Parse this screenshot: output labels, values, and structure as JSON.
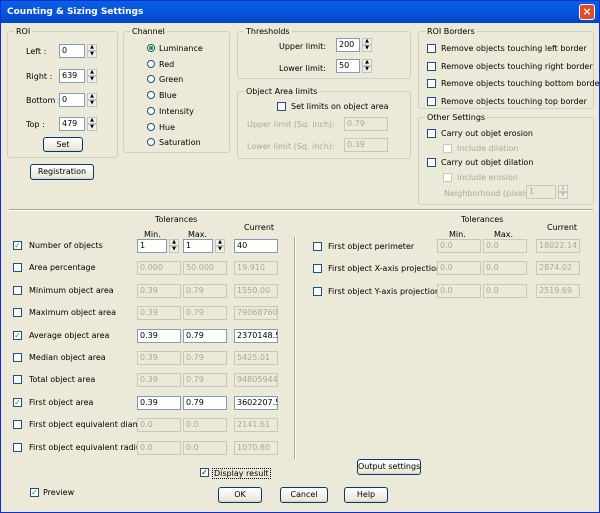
{
  "window": {
    "title": "Counting & Sizing Settings",
    "close": "×"
  },
  "roi": {
    "label": "ROI",
    "fields": [
      {
        "label": "Left :",
        "value": "0"
      },
      {
        "label": "Right :",
        "value": "639"
      },
      {
        "label": "Bottom :",
        "value": "0"
      },
      {
        "label": "Top :",
        "value": "479"
      }
    ],
    "set_label": "Set"
  },
  "channel": {
    "label": "Channel",
    "options": [
      "Luminance",
      "Red",
      "Green",
      "Blue",
      "Intensity",
      "Hue",
      "Saturation"
    ],
    "selected": "Luminance"
  },
  "thresholds": {
    "label": "Thresholds",
    "upper_label": "Upper limit:",
    "upper_value": "200",
    "lower_label": "Lower limit:",
    "lower_value": "50"
  },
  "area_limits": {
    "label": "Object Area limits",
    "set_label": "Set limits on object area",
    "upper_label": "Upper limit (Sq. inch):",
    "upper_value": "0.79",
    "lower_label": "Lower limit (Sq. inch):",
    "lower_value": "0.39"
  },
  "roi_borders": {
    "label": "ROI Borders",
    "items": [
      "Remove objects touching left border",
      "Remove objects touching right border",
      "Remove objects touching bottom border",
      "Remove objects touching top border"
    ]
  },
  "other": {
    "label": "Other Settings",
    "erosion": "Carry out objet erosion",
    "include_dilation": "Include dilation",
    "dilation": "Carry out objet dilation",
    "include_erosion": "Include erosion",
    "neighborhood_label": "Neighborhood (pixels):",
    "neighborhood_value": "1"
  },
  "registration_label": "Registration",
  "tolerances": {
    "header": "Tolerances",
    "min": "Min.",
    "max": "Max.",
    "current": "Current"
  },
  "left_rows": [
    {
      "label": "Number of objects",
      "checked": true,
      "min": "1",
      "max": "1",
      "current": "40",
      "spin": true
    },
    {
      "label": "Area percentage",
      "checked": false,
      "min": "0.000",
      "max": "50.000",
      "current": "19.910"
    },
    {
      "label": "Minimum object area",
      "checked": false,
      "min": "0.39",
      "max": "0.79",
      "current": "1550.00"
    },
    {
      "label": "Maximum object area",
      "checked": false,
      "min": "0.39",
      "max": "0.79",
      "current": "79068760."
    },
    {
      "label": "Average object area",
      "checked": true,
      "min": "0.39",
      "max": "0.79",
      "current": "2370148.5"
    },
    {
      "label": "Median object area",
      "checked": false,
      "min": "0.39",
      "max": "0.79",
      "current": "5425.01"
    },
    {
      "label": "Total object area",
      "checked": false,
      "min": "0.39",
      "max": "0.79",
      "current": "94805944."
    },
    {
      "label": "First object area",
      "checked": true,
      "min": "0.39",
      "max": "0.79",
      "current": "3602207.5"
    },
    {
      "label": "First object equivalent diameter",
      "checked": false,
      "min": "0.0",
      "max": "0.0",
      "current": "2141.61"
    },
    {
      "label": "First object equivalent radius",
      "checked": false,
      "min": "0.0",
      "max": "0.0",
      "current": "1070.80"
    }
  ],
  "right_rows": [
    {
      "label": "First object perimeter",
      "checked": false,
      "min": "0.0",
      "max": "0.0",
      "current": "18022.14"
    },
    {
      "label": "First object X-axis projection",
      "checked": false,
      "min": "0.0",
      "max": "0.0",
      "current": "2874.02"
    },
    {
      "label": "First object Y-axis projection",
      "checked": false,
      "min": "0.0",
      "max": "0.0",
      "current": "2519.69"
    }
  ],
  "display_result": "Display result",
  "output_settings": "Output settings",
  "preview": "Preview",
  "ok": "OK",
  "cancel": "Cancel",
  "help": "Help"
}
